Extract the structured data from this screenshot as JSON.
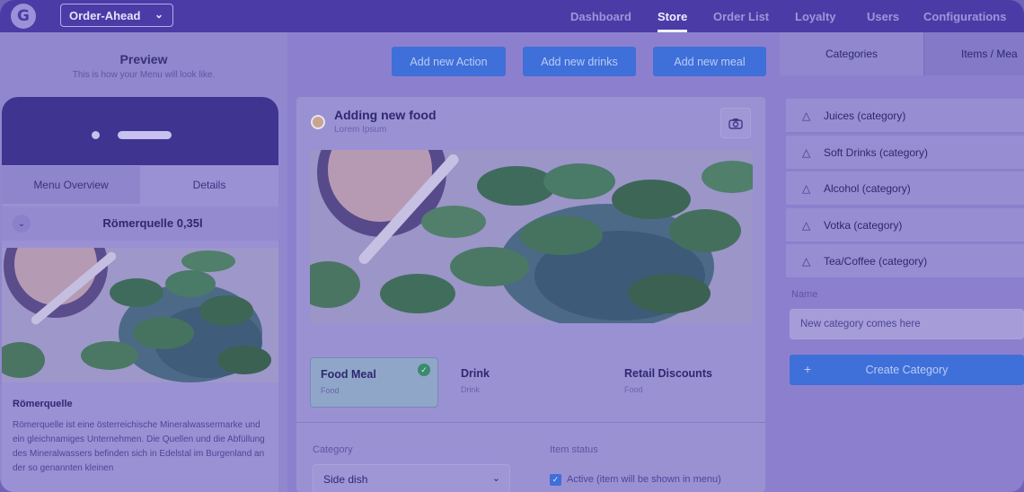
{
  "topbar": {
    "logo": "G",
    "store_selector": "Order-Ahead",
    "nav": [
      "Dashboard",
      "Store",
      "Order List",
      "Loyalty",
      "Users",
      "Configurations"
    ],
    "active_nav": "Store"
  },
  "preview": {
    "title": "Preview",
    "subtitle": "This is how your Menu will look like.",
    "tabs": [
      "Menu Overview",
      "Details"
    ],
    "product_name": "Römerquelle 0,35l",
    "description_title": "Römerquelle",
    "description": "Römerquelle ist eine österreichische Mineralwassermarke und ein gleichnamiges Unternehmen. Die Quellen und die Abfüllung des Mineralwassers befinden sich in Edelstal im Burgenland an der so genannten kleinen"
  },
  "actions": {
    "add_action": "Add new Action",
    "add_drinks": "Add new drinks",
    "add_meal": "Add new meal"
  },
  "editor": {
    "title": "Adding new food",
    "subtitle": "Lorem Ipsum",
    "types": [
      {
        "title": "Food Meal",
        "sub": "Food",
        "selected": true
      },
      {
        "title": "Drink",
        "sub": "Drink",
        "selected": false
      },
      {
        "title": "Retail Discounts",
        "sub": "Food",
        "selected": false
      }
    ],
    "category_label": "Category",
    "category_value": "Side dish",
    "status_label": "Item status",
    "active_label": "Active (item will be shown in menu)",
    "active_checked": true
  },
  "categories_panel": {
    "tabs": [
      "Categories",
      "Items / Mea"
    ],
    "items": [
      "Juices (category)",
      "Soft Drinks (category)",
      "Alcohol (category)",
      "Votka (category)",
      "Tea/Coffee (category)"
    ],
    "name_label": "Name",
    "name_value": "New category comes here",
    "create_button": "Create Category"
  },
  "colors": {
    "overlay": "#8c80ce",
    "nav": "#4b3ba6",
    "button": "#3f6fd8"
  }
}
